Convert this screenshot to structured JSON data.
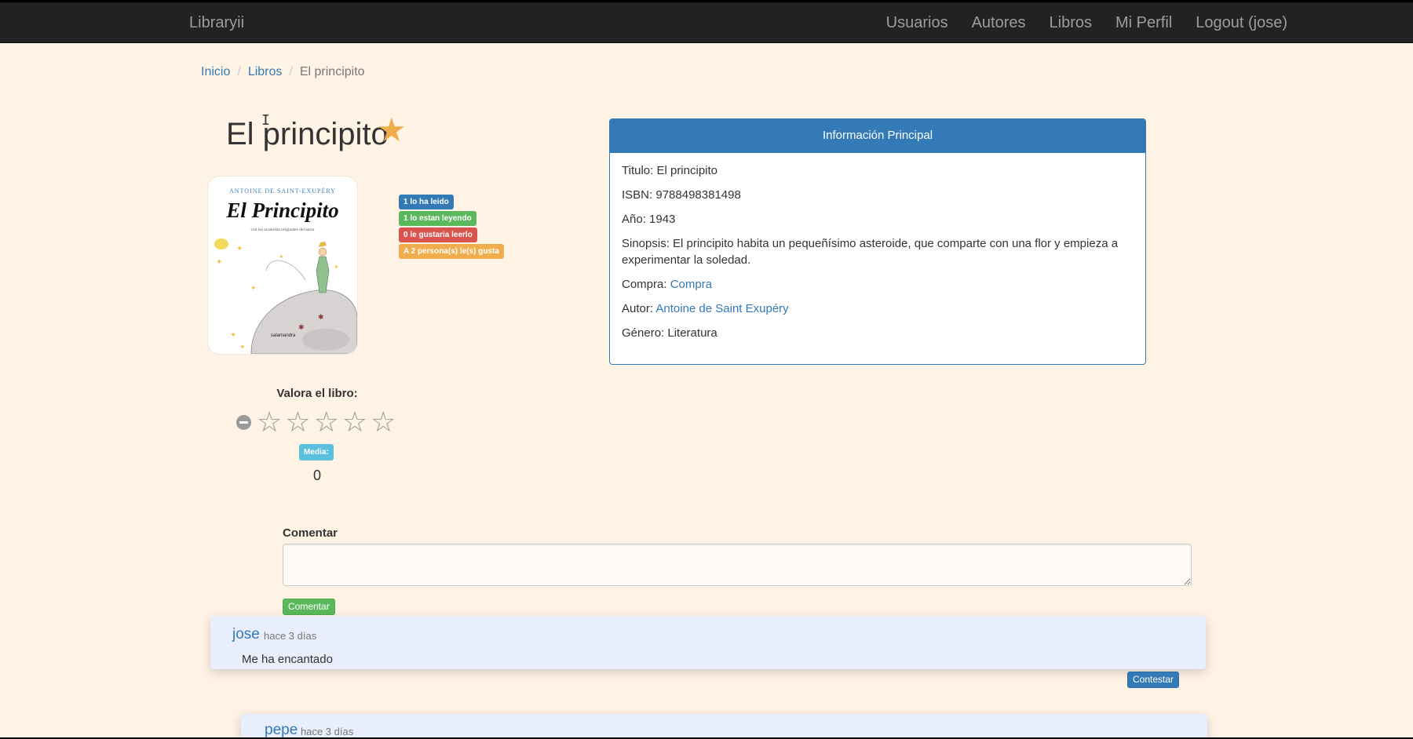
{
  "navbar": {
    "brand": "Libraryii",
    "links": [
      "Usuarios",
      "Autores",
      "Libros",
      "Mi Perfil",
      "Logout (jose)"
    ]
  },
  "breadcrumb": {
    "items": [
      "Inicio",
      "Libros"
    ],
    "active": "El principito",
    "separator": "/"
  },
  "book": {
    "title": "El principito",
    "favorite_icon": "star-icon",
    "cover": {
      "author": "ANTOINE DE SAINT-EXUPÉRY",
      "title": "El Principito",
      "subtitle": "con las acuarelas originales del autor",
      "publisher": "salamandra"
    },
    "badges": [
      {
        "label": "1 lo ha leido",
        "color": "#337ab7"
      },
      {
        "label": "1 lo estan leyendo",
        "color": "#5cb85c"
      },
      {
        "label": "0 le gustaria leerlo",
        "color": "#d9534f"
      },
      {
        "label": "A 2 persona(s) le(s) gusta",
        "color": "#f0ad4e"
      }
    ]
  },
  "info_panel": {
    "heading": "Información Principal",
    "titulo_label": "Titulo:",
    "titulo_value": "El principito",
    "isbn_label": "ISBN:",
    "isbn_value": "9788498381498",
    "anio_label": "Año:",
    "anio_value": "1943",
    "sinopsis_label": "Sinopsis:",
    "sinopsis_value": "El principito habita un pequeñísimo asteroide, que comparte con una flor y empieza a experimentar la soledad.",
    "compra_label": "Compra:",
    "compra_link": "Compra",
    "autor_label": "Autor:",
    "autor_link": "Antoine de Saint Exupéry",
    "genero_label": "Género:",
    "genero_value": "Literatura"
  },
  "rating": {
    "label": "Valora el libro:",
    "stars": 5,
    "selected": 0,
    "media_label": "Media:",
    "media_value": "0"
  },
  "comment_form": {
    "label": "Comentar",
    "textarea_value": "",
    "submit": "Comentar"
  },
  "comments": [
    {
      "user": "jose",
      "when": "hace 3 días",
      "text": "Me ha encantado",
      "reply_button": "Contestar"
    },
    {
      "user": "pepe",
      "when": "hace 3 días"
    }
  ],
  "colors": {
    "navbar": "#222222",
    "background": "#fff3e6",
    "primary": "#337ab7",
    "success": "#5cb85c",
    "danger": "#d9534f",
    "warning": "#f0ad4e",
    "info": "#5bc0de"
  }
}
